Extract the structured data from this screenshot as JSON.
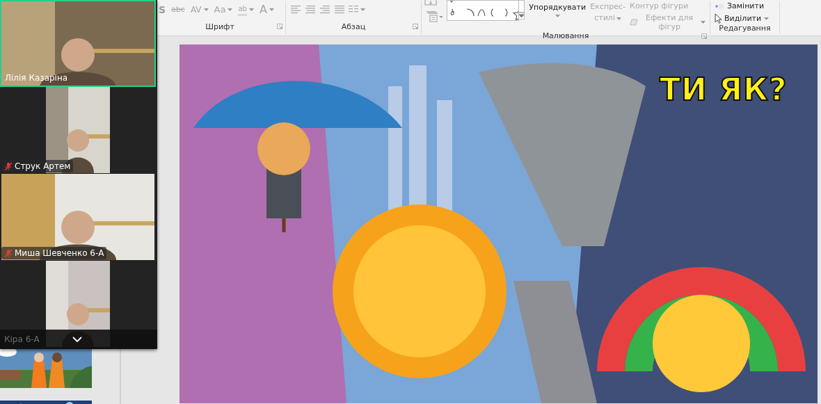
{
  "ribbon": {
    "font_tools": [
      {
        "label": "S",
        "kind": "shadow",
        "caret": false
      },
      {
        "label": "abc",
        "kind": "strike",
        "caret": false
      },
      {
        "label": "AV",
        "kind": "spacing",
        "caret": true
      },
      {
        "label": "Aa",
        "kind": "case",
        "caret": true
      },
      {
        "label": "ab",
        "kind": "highlight",
        "caret": true
      },
      {
        "label": "A",
        "kind": "color",
        "caret": true
      }
    ],
    "groups": [
      {
        "label": "Шрифт",
        "kind": "font"
      },
      {
        "label": "Абзац",
        "kind": "paragraph"
      },
      {
        "label": "Малювання",
        "kind": "drawing"
      },
      {
        "label": "Редагування",
        "kind": "editing"
      }
    ],
    "drawing_buttons": [
      {
        "label": "Упорядкувати",
        "kind": "arrange",
        "disabled": false
      },
      {
        "label": "Експрес-стилі",
        "kind": "styles",
        "disabled": true
      },
      {
        "label": "Контур фігури",
        "kind": "outline",
        "disabled": true
      },
      {
        "label": "Ефекти для фігур",
        "kind": "effects",
        "disabled": true
      }
    ],
    "editing_buttons": [
      {
        "label": "Замінити",
        "kind": "replace",
        "disabled": false
      },
      {
        "label": "Виділити",
        "kind": "select",
        "disabled": false
      }
    ]
  },
  "slide": {
    "title": "ТИ ЯК?"
  },
  "participants": [
    {
      "name": "Лілія Казаріна",
      "kind": "wide",
      "muted": false,
      "speaking": true,
      "dimmed": false
    },
    {
      "name": "Струк Артем",
      "kind": "portrait",
      "muted": true,
      "speaking": false,
      "dimmed": false
    },
    {
      "name": "Миша Шевченко 6-А",
      "kind": "wide",
      "muted": true,
      "speaking": false,
      "dimmed": false
    },
    {
      "name": "Кіра 6-А",
      "kind": "portrait",
      "muted": false,
      "speaking": false,
      "dimmed": true
    }
  ]
}
